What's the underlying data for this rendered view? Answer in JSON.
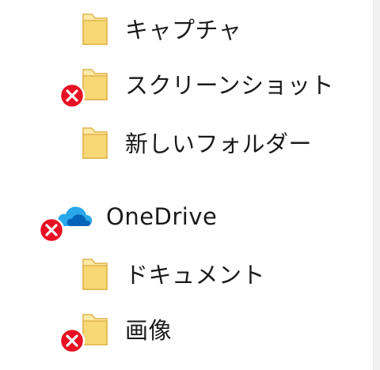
{
  "nav_tree": {
    "items": [
      {
        "label": "キャプチャ",
        "icon": "folder-icon",
        "sync_error": false
      },
      {
        "label": "スクリーンショット",
        "icon": "folder-icon",
        "sync_error": true
      },
      {
        "label": "新しいフォルダー",
        "icon": "folder-icon",
        "sync_error": false
      },
      {
        "label": "OneDrive",
        "icon": "onedrive-cloud-icon",
        "sync_error": true
      },
      {
        "label": "ドキュメント",
        "icon": "folder-icon",
        "sync_error": false
      },
      {
        "label": "画像",
        "icon": "folder-icon",
        "sync_error": true
      }
    ]
  },
  "colors": {
    "folder_body": "#f8d775",
    "folder_light": "#ffe9a6",
    "folder_edge": "#e0b44c",
    "error_red": "#e81123",
    "onedrive_blue": "#0364b8",
    "onedrive_light": "#28a8ea",
    "text": "#1a1a1a"
  }
}
